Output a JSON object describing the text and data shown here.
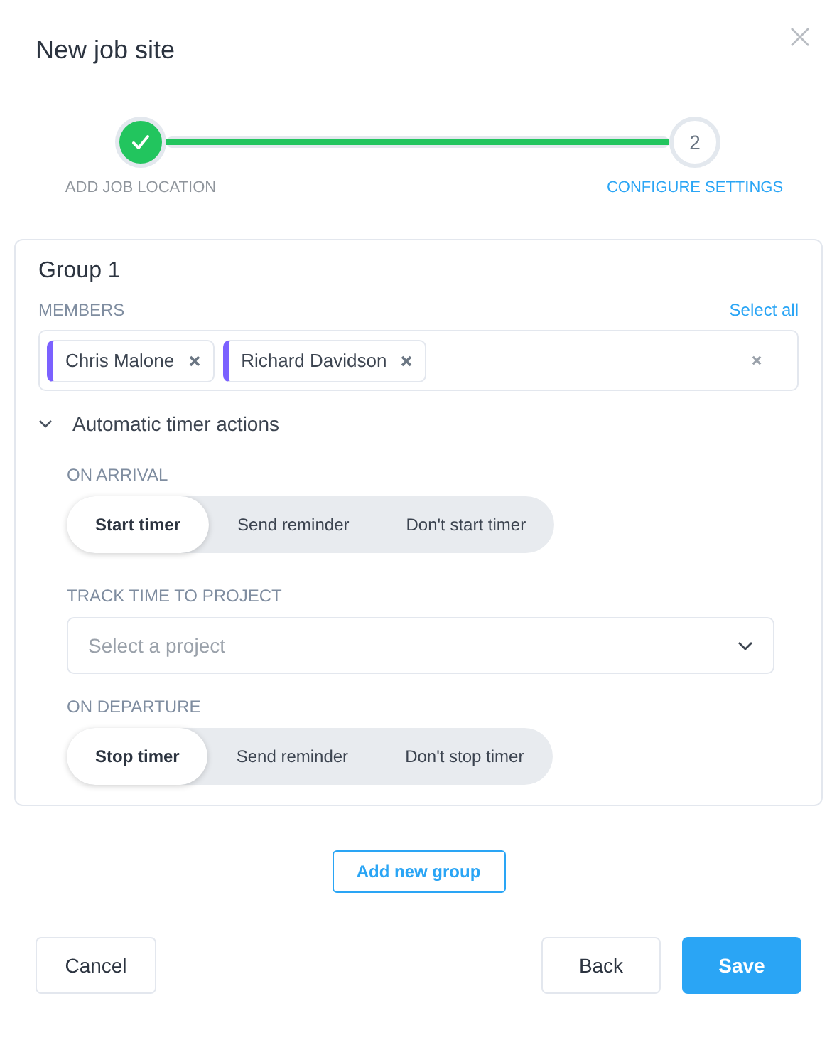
{
  "dialog": {
    "title": "New job site"
  },
  "steps": [
    {
      "label": "ADD JOB LOCATION",
      "completed": true,
      "selected": false
    },
    {
      "label": "CONFIGURE SETTINGS",
      "number": "2",
      "completed": false,
      "selected": true
    }
  ],
  "group": {
    "title": "Group 1",
    "members_label": "MEMBERS",
    "select_all": "Select all",
    "members": [
      {
        "name": "Chris Malone",
        "color": "#7b61ff"
      },
      {
        "name": "Richard Davidson",
        "color": "#7b61ff"
      }
    ],
    "timer_section": {
      "title": "Automatic timer actions",
      "expanded": true,
      "on_arrival": {
        "label": "ON ARRIVAL",
        "options": [
          {
            "label": "Start timer",
            "selected": true
          },
          {
            "label": "Send reminder",
            "selected": false
          },
          {
            "label": "Don't start timer",
            "selected": false
          }
        ]
      },
      "project": {
        "label": "TRACK TIME TO PROJECT",
        "placeholder": "Select a project"
      },
      "on_departure": {
        "label": "ON DEPARTURE",
        "options": [
          {
            "label": "Stop timer",
            "selected": true
          },
          {
            "label": "Send reminder",
            "selected": false
          },
          {
            "label": "Don't stop timer",
            "selected": false
          }
        ]
      }
    }
  },
  "add_group_button": "Add new group",
  "footer": {
    "cancel": "Cancel",
    "back": "Back",
    "save": "Save"
  }
}
